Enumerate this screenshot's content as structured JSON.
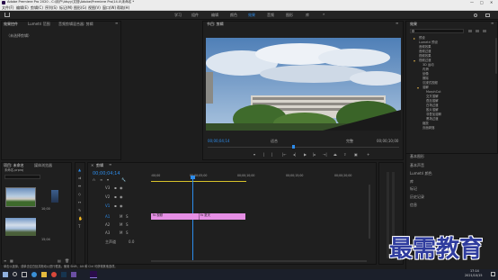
{
  "titlebar": {
    "title": "Adobe Premiere Pro 2020 - C:\\用户\\ldsyy\\文档\\Adobe\\Premiere Pro\\14.0\\未命名 *",
    "controls": [
      "—",
      "□",
      "✕"
    ]
  },
  "menu": [
    "文件(F)",
    "编辑(E)",
    "剪辑(C)",
    "序列(S)",
    "标记(M)",
    "图形(G)",
    "视图(V)",
    "窗口(W)",
    "帮助(H)"
  ],
  "workspaces": [
    "学习",
    "组件",
    "编辑",
    "颜色",
    "效果",
    "音频",
    "图形",
    "库"
  ],
  "workspace_active": "效果",
  "source_panel": {
    "tabs": [
      "效果控件",
      "Lumetri 范围",
      "音频剪辑混合器: 剪辑"
    ],
    "placeholder": "（未选择剪辑）"
  },
  "program": {
    "title": "节目: 剪辑",
    "timecode": "00;00;04;14",
    "fit": "适合",
    "quality": "完整",
    "duration": "00;00;10;00"
  },
  "project": {
    "tabs": [
      "项目: 未命名",
      "媒体浏览器"
    ],
    "file": "未命名.prproj",
    "items": [
      {
        "name": "剪辑",
        "label": "10;00"
      },
      {
        "name": "视频.mp4",
        "label": ""
      },
      {
        "name": "夏天.mp4",
        "label": "15;04"
      }
    ]
  },
  "timeline": {
    "tab": "剪辑",
    "timecode": "00;00;04;14",
    "ruler": [
      ":00;00",
      "00;00;05;00",
      "00;00;10;00",
      "00;00;15;00",
      "00;00;20;00"
    ],
    "video_tracks": [
      "V3",
      "V2",
      "V1"
    ],
    "audio_tracks": [
      "A1",
      "A2",
      "A3"
    ],
    "master": "主声道",
    "master_value": "0.0",
    "clips": [
      "fx 视频",
      "fx 夏天"
    ]
  },
  "effects": {
    "title": "效果",
    "folders": [
      "预设",
      "Lumetri 预设",
      "音频效果",
      "音频过渡",
      "视频效果",
      "视频过渡",
      "3D 运动",
      "内滑",
      "划像",
      "擦除",
      "沉浸式视频",
      "溶解",
      "MorphCut",
      "交叉溶解",
      "叠加溶解",
      "白场过渡",
      "胶片溶解",
      "非叠加溶解",
      "黑场过渡",
      "缩放",
      "页面剥落"
    ],
    "sections": [
      "基本图形",
      "基本声音",
      "Lumetri 颜色",
      "库",
      "标记",
      "历史记录",
      "信息"
    ]
  },
  "status": "单击以选择，或单击空白处并拖动以进行框选。使用 Shift、Alt 和 Ctrl 可获得其他选项。",
  "taskbar": {
    "time": "17:14",
    "date": "2021/10/15"
  },
  "watermark": "最需教育",
  "colors": {
    "accent": "#2d8ceb",
    "clip": "#e68fe5",
    "playhead": "#2d8ceb"
  }
}
